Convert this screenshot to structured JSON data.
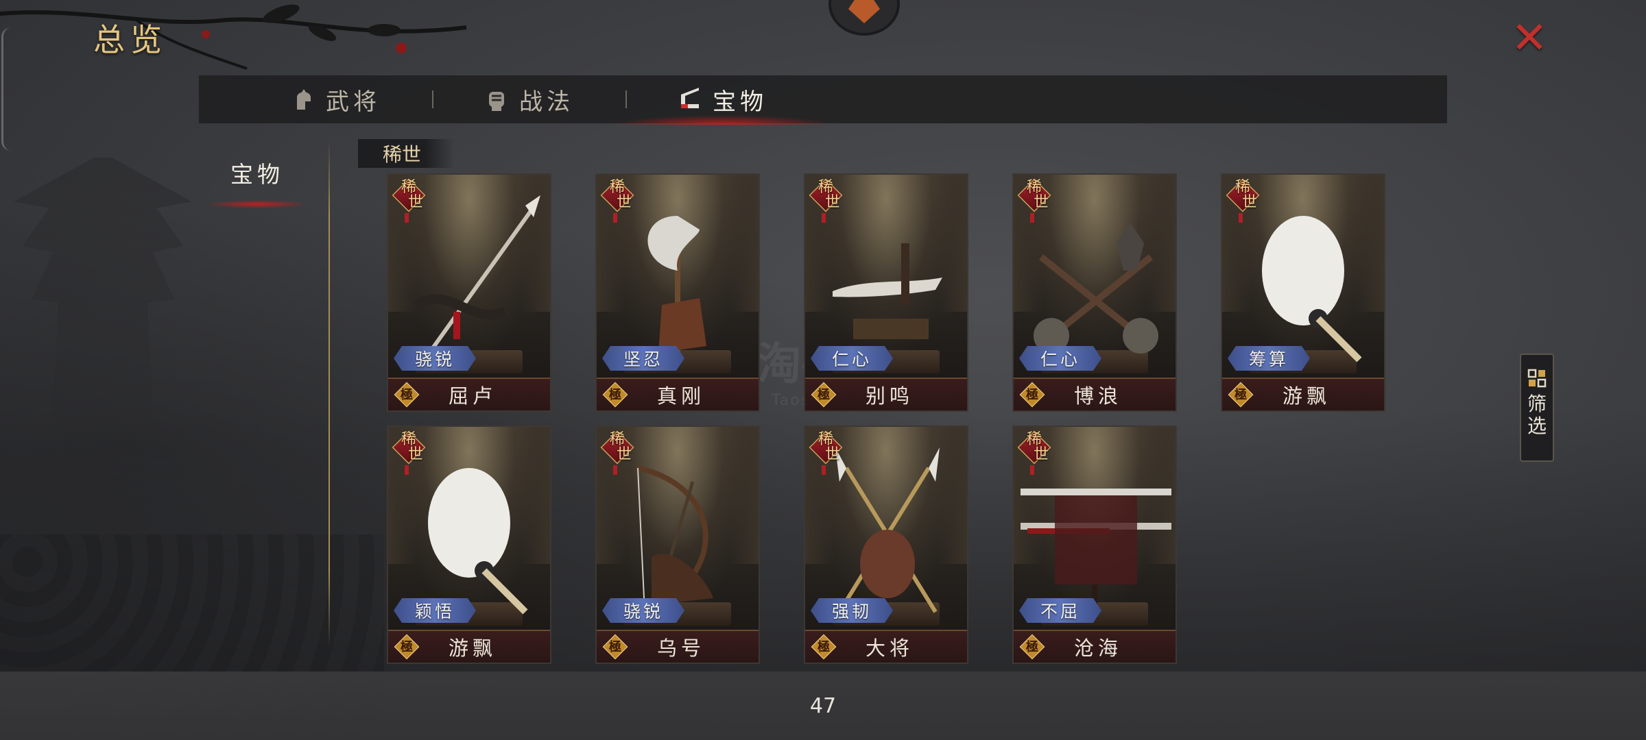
{
  "header": {
    "title": "总览",
    "close_icon": "close-icon"
  },
  "tabs": [
    {
      "label": "武将",
      "icon": "general-helmet-icon",
      "active": false
    },
    {
      "label": "战法",
      "icon": "fist-tactic-icon",
      "active": false
    },
    {
      "label": "宝物",
      "icon": "treasure-icon",
      "active": true
    }
  ],
  "sidebar": {
    "items": [
      {
        "label": "宝物",
        "active": true
      }
    ]
  },
  "section": {
    "label": "稀世"
  },
  "cards": [
    {
      "rarity_top": "稀",
      "rarity_bottom": "世",
      "trait": "骁锐",
      "grade": "極",
      "name": "屈卢",
      "weapon": "spear"
    },
    {
      "rarity_top": "稀",
      "rarity_bottom": "世",
      "trait": "坚忍",
      "grade": "極",
      "name": "真刚",
      "weapon": "axe"
    },
    {
      "rarity_top": "稀",
      "rarity_bottom": "世",
      "trait": "仁心",
      "grade": "極",
      "name": "别鸣",
      "weapon": "dagger"
    },
    {
      "rarity_top": "稀",
      "rarity_bottom": "世",
      "trait": "仁心",
      "grade": "極",
      "name": "博浪",
      "weapon": "hammers"
    },
    {
      "rarity_top": "稀",
      "rarity_bottom": "世",
      "trait": "筹算",
      "grade": "極",
      "name": "游飘",
      "weapon": "fan"
    },
    {
      "rarity_top": "稀",
      "rarity_bottom": "世",
      "trait": "颖悟",
      "grade": "極",
      "name": "游飘",
      "weapon": "fan"
    },
    {
      "rarity_top": "稀",
      "rarity_bottom": "世",
      "trait": "骁锐",
      "grade": "極",
      "name": "乌号",
      "weapon": "bow"
    },
    {
      "rarity_top": "稀",
      "rarity_bottom": "世",
      "trait": "强韧",
      "grade": "極",
      "name": "大将",
      "weapon": "halberds"
    },
    {
      "rarity_top": "稀",
      "rarity_bottom": "世",
      "trait": "不屈",
      "grade": "極",
      "name": "沧海",
      "weapon": "sword"
    }
  ],
  "filter": {
    "label": "筛选",
    "icon": "grid-filter-icon"
  },
  "footer": {
    "page_count": "47"
  },
  "watermark": {
    "text": "淘手游",
    "sub": "Taoshouyou"
  },
  "colors": {
    "accent_gold": "#e6c67f",
    "close_red": "#c2302c",
    "active_glow": "#c81e1e",
    "trait_blue": "#5c73b8"
  }
}
